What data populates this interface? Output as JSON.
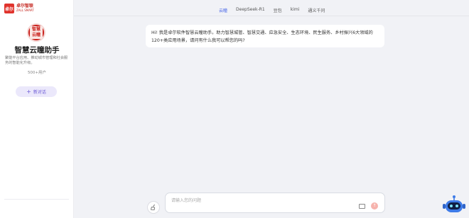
{
  "brand": {
    "logo_mark": "卓尔",
    "name_cn": "卓尔智联",
    "name_en": "ZALL SMART"
  },
  "assistant": {
    "seal_text": "智慧\n云瞳",
    "name": "智慧云瞳助手",
    "description": "聚能平台应用、推动城市管理和社会服务的智能化升级。",
    "user_count": "500+用户"
  },
  "new_chat_label": "新对话",
  "tabs": [
    {
      "label": "云瞳",
      "active": true
    },
    {
      "label": "DeepSeek-R1",
      "active": false
    },
    {
      "label": "豆包",
      "active": false
    },
    {
      "label": "kimi",
      "active": false
    },
    {
      "label": "通义千问",
      "active": false
    }
  ],
  "welcome_message": "Hi! 我是卓尔软件智慧云瞳助手。助力智慧城管、智慧交通、应急安全、生态环境、民生服务、乡村振兴6大领域的120+类应用场景，请问有什么我可以帮您的吗?",
  "input": {
    "placeholder": "请输入您的问题"
  },
  "colors": {
    "accent": "#4a67e8",
    "brand_red": "#c9201b",
    "new_chat_bg": "#ebe8fb"
  }
}
